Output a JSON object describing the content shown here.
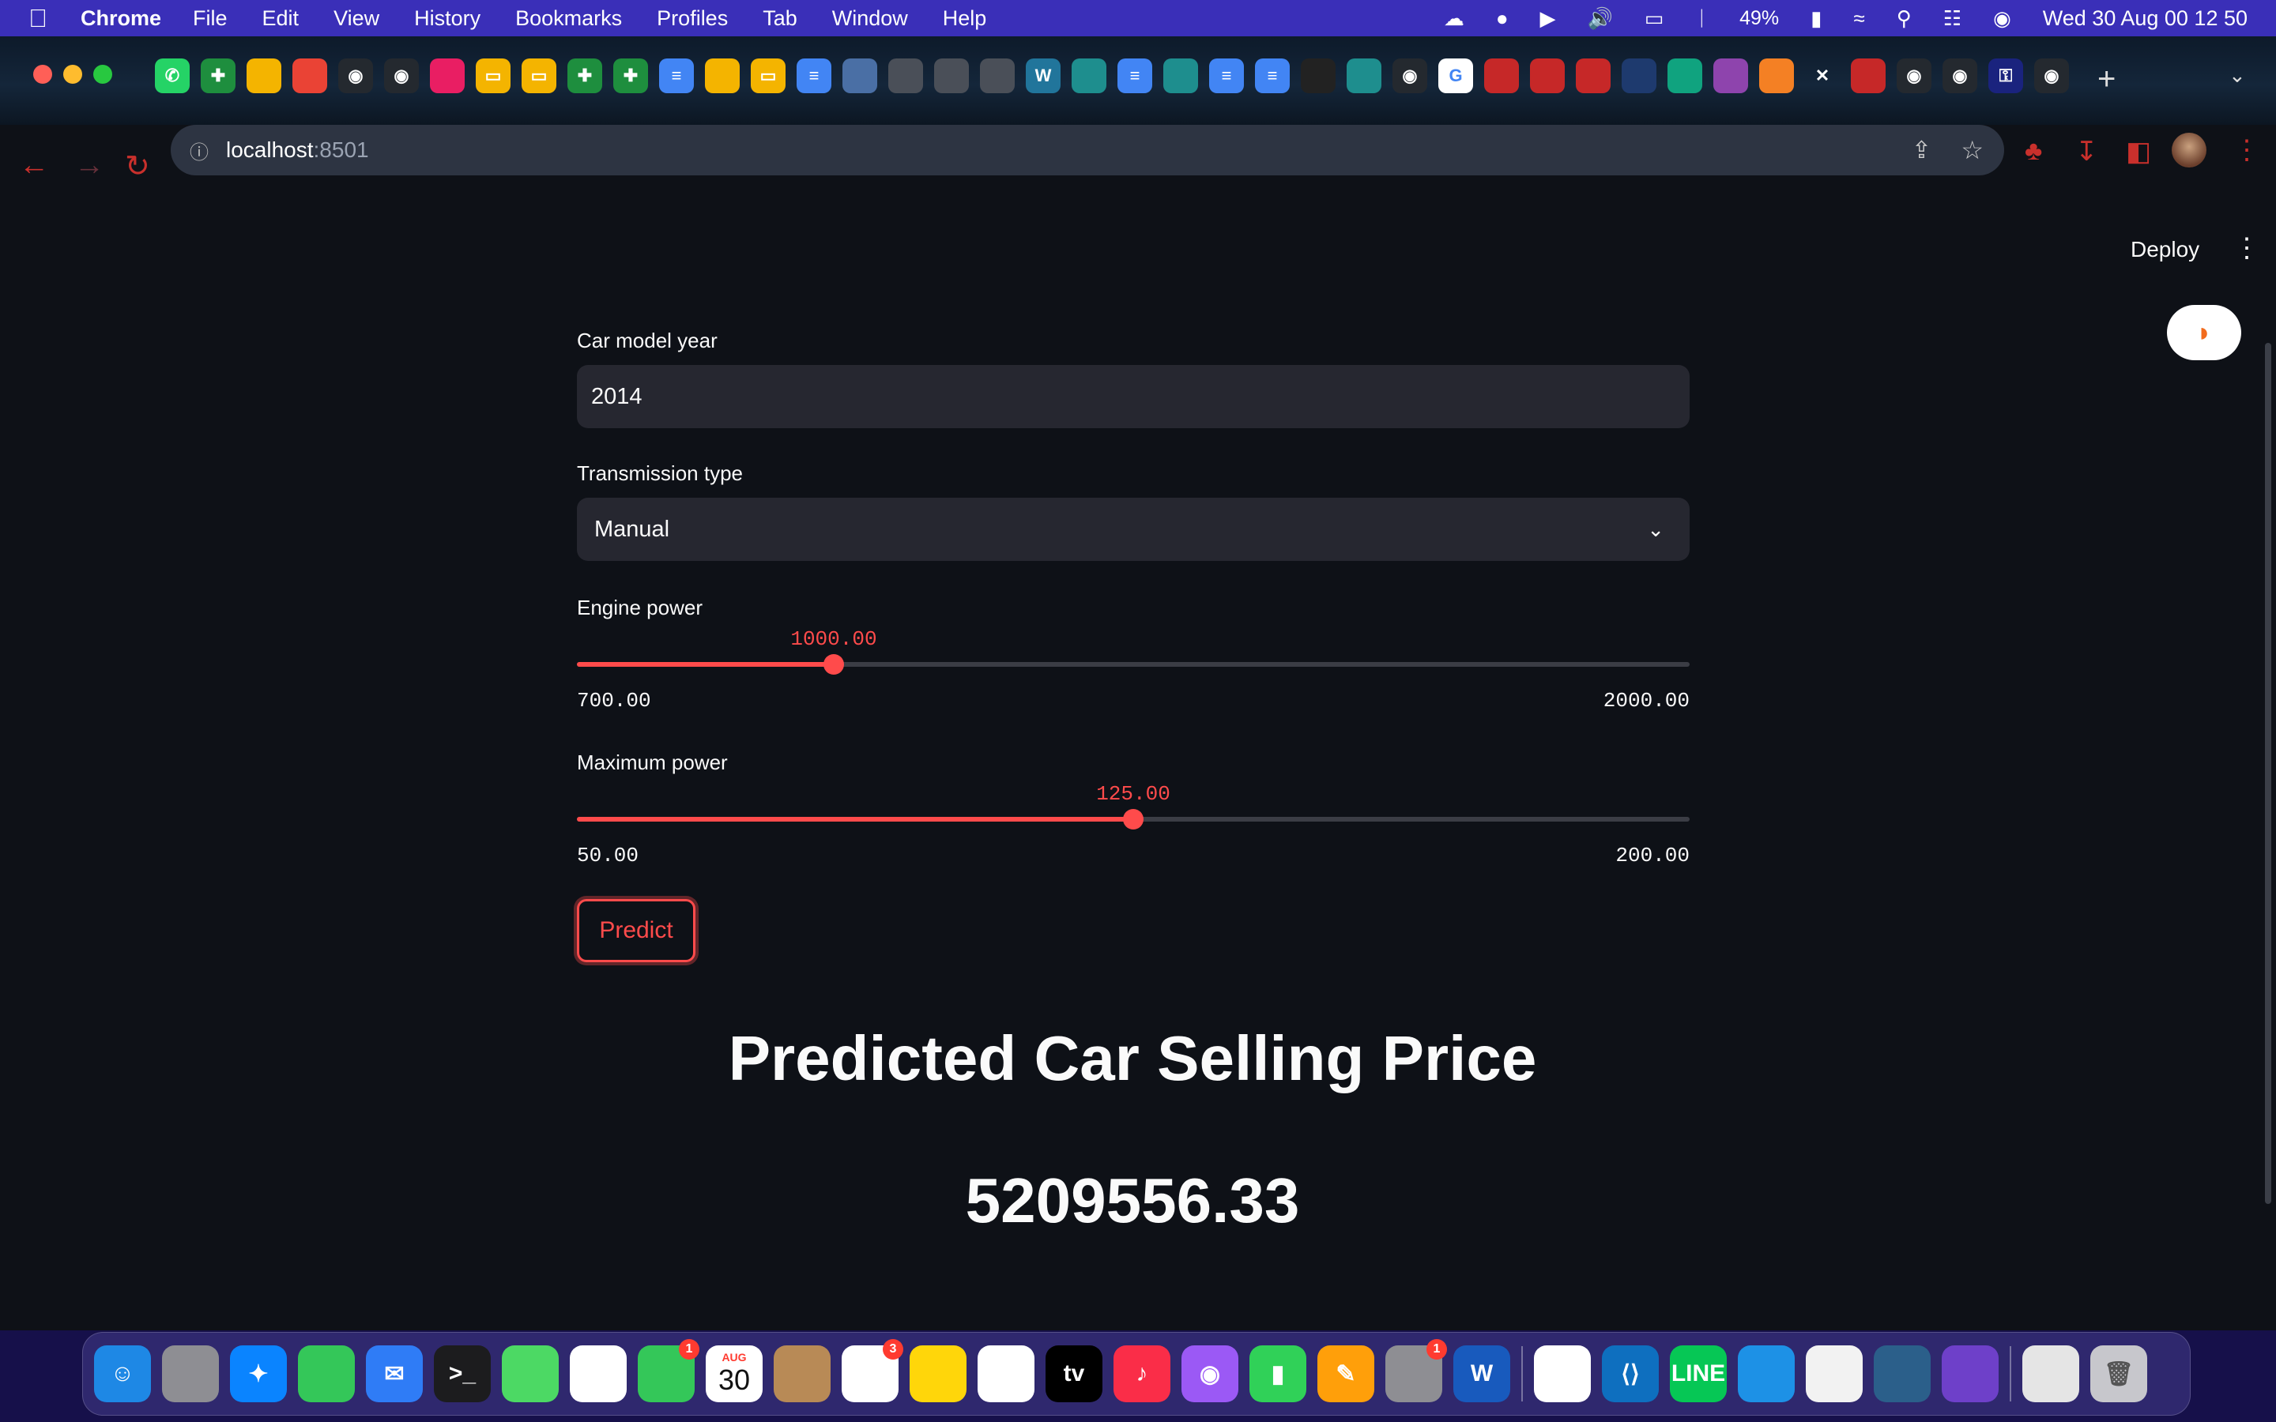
{
  "menubar": {
    "apple_icon": "apple-icon",
    "app_name": "Chrome",
    "menus": [
      "File",
      "Edit",
      "View",
      "History",
      "Bookmarks",
      "Profiles",
      "Tab",
      "Window",
      "Help"
    ],
    "battery": "49%",
    "datetime": "Wed 30 Aug  00 12 50"
  },
  "browser": {
    "url_host": "localhost",
    "url_port": ":8501",
    "tab_icons": [
      "whatsapp",
      "sheets",
      "drive",
      "gmail",
      "github",
      "github",
      "contacts",
      "slides",
      "slides",
      "sheets",
      "sheets",
      "docs",
      "drive",
      "slides",
      "docs",
      "website",
      "grey",
      "grey",
      "grey",
      "wordpress",
      "classroom",
      "docs",
      "classroom",
      "docs",
      "docs",
      "podcast",
      "classroom",
      "github",
      "google",
      "red-app",
      "red-app",
      "red-app",
      "blue-app",
      "chatgpt",
      "purple-app",
      "stack",
      "close",
      "red-app",
      "github",
      "github",
      "key",
      "github"
    ]
  },
  "app": {
    "deploy_label": "Deploy",
    "year": {
      "label": "Car model year",
      "value": "2014"
    },
    "transmission": {
      "label": "Transmission type",
      "value": "Manual"
    },
    "engine_power": {
      "label": "Engine power",
      "value": "1000.00",
      "min": "700.00",
      "max": "2000.00",
      "fraction": 0.2308
    },
    "max_power": {
      "label": "Maximum power",
      "value": "125.00",
      "min": "50.00",
      "max": "200.00",
      "fraction": 0.5
    },
    "predict_label": "Predict",
    "result_title": "Predicted Car Selling Price",
    "result_value": "5209556.33"
  },
  "dock": {
    "apps": [
      "Finder",
      "Launchpad",
      "Safari",
      "Messages",
      "Mail",
      "Terminal",
      "Maps",
      "Photos",
      "FaceTime",
      "Calendar",
      "Contacts",
      "Reminders",
      "Notes",
      "Freeform",
      "TV",
      "Music",
      "Podcasts",
      "Numbers",
      "Pages",
      "System Settings",
      "Word",
      "Chrome",
      "VS Code",
      "LINE",
      "Docker",
      "TextEdit",
      "MySQL Workbench",
      "GitHub Desktop",
      "Document",
      "Trash"
    ],
    "calendar_month": "AUG",
    "calendar_day": "30",
    "facetime_badge": "1",
    "reminders_badge": "3",
    "settings_badge": "1"
  },
  "colors": {
    "accent": "#ff4b4b",
    "app_bg": "#0e1117",
    "input_bg": "#262730",
    "menubar_bg": "#3a2fb8"
  }
}
